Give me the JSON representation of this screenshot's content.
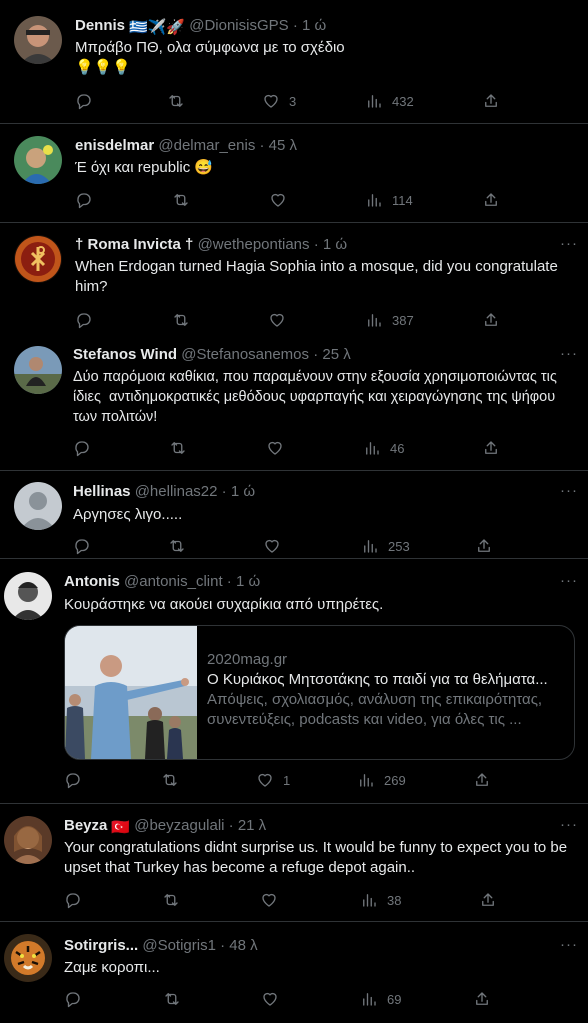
{
  "tweets": [
    {
      "name": "Dennis",
      "flags": "🇬🇷✈️🚀",
      "handle": "@DionisisGPS",
      "time": "· 1 ώ",
      "text": "Μπράβο ΠΘ, ολα σύμφωνα με το σχέδιο\n💡💡💡",
      "replies": "",
      "retweets": "",
      "likes": "3",
      "views": "432"
    },
    {
      "name": "enisdelmar",
      "flags": "",
      "handle": "@delmar_enis",
      "time": "· 45 λ",
      "text": "Έ όχι και republic 😅",
      "replies": "",
      "retweets": "",
      "likes": "",
      "views": "114"
    },
    {
      "name": "† Roma Invicta †",
      "flags": "",
      "handle": "@wethepontians",
      "time": "· 1 ώ",
      "text": "When Erdogan turned Hagia Sophia into a mosque, did you congratulate him?",
      "replies": "",
      "retweets": "",
      "likes": "",
      "views": "387"
    },
    {
      "name": "Stefanos Wind",
      "flags": "",
      "handle": "@Stefanosanemos",
      "time": "· 25 λ",
      "text": "Δύο παρόμοια καθίκια, που παραμένουν στην εξουσία χρησιμοποιώντας τις ίδιες  αντιδημοκρατικές μεθόδους υφαρπαγής και χειραγώγησης της ψήφου των πολιτών!",
      "replies": "",
      "retweets": "",
      "likes": "",
      "views": "46"
    },
    {
      "name": "Hellinas",
      "flags": "",
      "handle": "@hellinas22",
      "time": "· 1 ώ",
      "text": "Αργησες λιγο.....",
      "replies": "",
      "retweets": "",
      "likes": "",
      "views": "253"
    },
    {
      "name": "Antonis",
      "flags": "",
      "handle": "@antonis_clint",
      "time": "· 1 ώ",
      "text": "Κουράστηκε να ακούει συχαρίκια από υπηρέτες.",
      "replies": "",
      "retweets": "",
      "likes": "1",
      "views": "269"
    },
    {
      "name": "Beyza",
      "flags": "🇹🇷",
      "handle": "@beyzagulali",
      "time": "· 21 λ",
      "text": "Your congratulations didnt surprise us. It would be funny to expect you to be upset that Turkey has become a refuge depot again..",
      "replies": "",
      "retweets": "",
      "likes": "",
      "views": "38"
    },
    {
      "name": "Sotirgris...",
      "flags": "",
      "handle": "@Sotigris1",
      "time": "· 48 λ",
      "text": "Ζαμε κοροπι...",
      "replies": "",
      "retweets": "",
      "likes": "",
      "views": "69"
    }
  ],
  "card": {
    "domain": "2020mag.gr",
    "title": "Ο Κυριάκος Μητσοτάκης το παιδί για τα θελήματα...",
    "description": "Απόψεις, σχολιασμός, ανάλυση της επικαιρότητας, συνεντεύξεις, podcasts και video, για όλες τις ..."
  },
  "more_label": "···",
  "colors": {
    "background": "#000000",
    "text": "#e7e9ea",
    "muted": "#71767b",
    "divider": "#2f3336"
  }
}
